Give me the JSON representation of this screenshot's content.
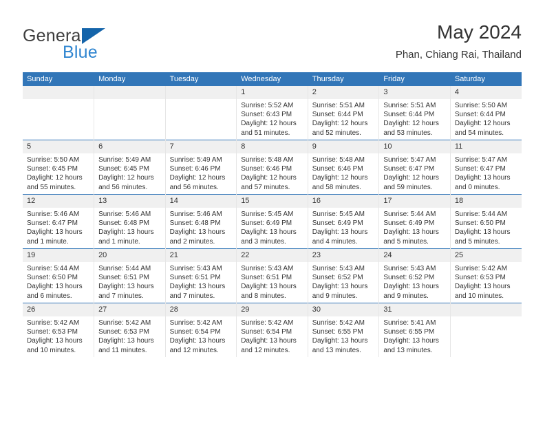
{
  "brand": {
    "name_top": "General",
    "name_bottom": "Blue",
    "triangle_color": "#1464AA",
    "blue_color": "#2F85D0"
  },
  "header": {
    "title": "May 2024",
    "subtitle": "Phan, Chiang Rai, Thailand"
  },
  "theme": {
    "header_blue": "#3276B8",
    "daynum_bg": "#F0F0F0",
    "text": "#333333"
  },
  "weekdays": [
    "Sunday",
    "Monday",
    "Tuesday",
    "Wednesday",
    "Thursday",
    "Friday",
    "Saturday"
  ],
  "weeks": [
    [
      {
        "day": "",
        "empty": true
      },
      {
        "day": "",
        "empty": true
      },
      {
        "day": "",
        "empty": true
      },
      {
        "day": "1",
        "sunrise": "Sunrise: 5:52 AM",
        "sunset": "Sunset: 6:43 PM",
        "daylight1": "Daylight: 12 hours",
        "daylight2": "and 51 minutes."
      },
      {
        "day": "2",
        "sunrise": "Sunrise: 5:51 AM",
        "sunset": "Sunset: 6:44 PM",
        "daylight1": "Daylight: 12 hours",
        "daylight2": "and 52 minutes."
      },
      {
        "day": "3",
        "sunrise": "Sunrise: 5:51 AM",
        "sunset": "Sunset: 6:44 PM",
        "daylight1": "Daylight: 12 hours",
        "daylight2": "and 53 minutes."
      },
      {
        "day": "4",
        "sunrise": "Sunrise: 5:50 AM",
        "sunset": "Sunset: 6:44 PM",
        "daylight1": "Daylight: 12 hours",
        "daylight2": "and 54 minutes."
      }
    ],
    [
      {
        "day": "5",
        "sunrise": "Sunrise: 5:50 AM",
        "sunset": "Sunset: 6:45 PM",
        "daylight1": "Daylight: 12 hours",
        "daylight2": "and 55 minutes."
      },
      {
        "day": "6",
        "sunrise": "Sunrise: 5:49 AM",
        "sunset": "Sunset: 6:45 PM",
        "daylight1": "Daylight: 12 hours",
        "daylight2": "and 56 minutes."
      },
      {
        "day": "7",
        "sunrise": "Sunrise: 5:49 AM",
        "sunset": "Sunset: 6:46 PM",
        "daylight1": "Daylight: 12 hours",
        "daylight2": "and 56 minutes."
      },
      {
        "day": "8",
        "sunrise": "Sunrise: 5:48 AM",
        "sunset": "Sunset: 6:46 PM",
        "daylight1": "Daylight: 12 hours",
        "daylight2": "and 57 minutes."
      },
      {
        "day": "9",
        "sunrise": "Sunrise: 5:48 AM",
        "sunset": "Sunset: 6:46 PM",
        "daylight1": "Daylight: 12 hours",
        "daylight2": "and 58 minutes."
      },
      {
        "day": "10",
        "sunrise": "Sunrise: 5:47 AM",
        "sunset": "Sunset: 6:47 PM",
        "daylight1": "Daylight: 12 hours",
        "daylight2": "and 59 minutes."
      },
      {
        "day": "11",
        "sunrise": "Sunrise: 5:47 AM",
        "sunset": "Sunset: 6:47 PM",
        "daylight1": "Daylight: 13 hours",
        "daylight2": "and 0 minutes."
      }
    ],
    [
      {
        "day": "12",
        "sunrise": "Sunrise: 5:46 AM",
        "sunset": "Sunset: 6:47 PM",
        "daylight1": "Daylight: 13 hours",
        "daylight2": "and 1 minute."
      },
      {
        "day": "13",
        "sunrise": "Sunrise: 5:46 AM",
        "sunset": "Sunset: 6:48 PM",
        "daylight1": "Daylight: 13 hours",
        "daylight2": "and 1 minute."
      },
      {
        "day": "14",
        "sunrise": "Sunrise: 5:46 AM",
        "sunset": "Sunset: 6:48 PM",
        "daylight1": "Daylight: 13 hours",
        "daylight2": "and 2 minutes."
      },
      {
        "day": "15",
        "sunrise": "Sunrise: 5:45 AM",
        "sunset": "Sunset: 6:49 PM",
        "daylight1": "Daylight: 13 hours",
        "daylight2": "and 3 minutes."
      },
      {
        "day": "16",
        "sunrise": "Sunrise: 5:45 AM",
        "sunset": "Sunset: 6:49 PM",
        "daylight1": "Daylight: 13 hours",
        "daylight2": "and 4 minutes."
      },
      {
        "day": "17",
        "sunrise": "Sunrise: 5:44 AM",
        "sunset": "Sunset: 6:49 PM",
        "daylight1": "Daylight: 13 hours",
        "daylight2": "and 5 minutes."
      },
      {
        "day": "18",
        "sunrise": "Sunrise: 5:44 AM",
        "sunset": "Sunset: 6:50 PM",
        "daylight1": "Daylight: 13 hours",
        "daylight2": "and 5 minutes."
      }
    ],
    [
      {
        "day": "19",
        "sunrise": "Sunrise: 5:44 AM",
        "sunset": "Sunset: 6:50 PM",
        "daylight1": "Daylight: 13 hours",
        "daylight2": "and 6 minutes."
      },
      {
        "day": "20",
        "sunrise": "Sunrise: 5:44 AM",
        "sunset": "Sunset: 6:51 PM",
        "daylight1": "Daylight: 13 hours",
        "daylight2": "and 7 minutes."
      },
      {
        "day": "21",
        "sunrise": "Sunrise: 5:43 AM",
        "sunset": "Sunset: 6:51 PM",
        "daylight1": "Daylight: 13 hours",
        "daylight2": "and 7 minutes."
      },
      {
        "day": "22",
        "sunrise": "Sunrise: 5:43 AM",
        "sunset": "Sunset: 6:51 PM",
        "daylight1": "Daylight: 13 hours",
        "daylight2": "and 8 minutes."
      },
      {
        "day": "23",
        "sunrise": "Sunrise: 5:43 AM",
        "sunset": "Sunset: 6:52 PM",
        "daylight1": "Daylight: 13 hours",
        "daylight2": "and 9 minutes."
      },
      {
        "day": "24",
        "sunrise": "Sunrise: 5:43 AM",
        "sunset": "Sunset: 6:52 PM",
        "daylight1": "Daylight: 13 hours",
        "daylight2": "and 9 minutes."
      },
      {
        "day": "25",
        "sunrise": "Sunrise: 5:42 AM",
        "sunset": "Sunset: 6:53 PM",
        "daylight1": "Daylight: 13 hours",
        "daylight2": "and 10 minutes."
      }
    ],
    [
      {
        "day": "26",
        "sunrise": "Sunrise: 5:42 AM",
        "sunset": "Sunset: 6:53 PM",
        "daylight1": "Daylight: 13 hours",
        "daylight2": "and 10 minutes."
      },
      {
        "day": "27",
        "sunrise": "Sunrise: 5:42 AM",
        "sunset": "Sunset: 6:53 PM",
        "daylight1": "Daylight: 13 hours",
        "daylight2": "and 11 minutes."
      },
      {
        "day": "28",
        "sunrise": "Sunrise: 5:42 AM",
        "sunset": "Sunset: 6:54 PM",
        "daylight1": "Daylight: 13 hours",
        "daylight2": "and 12 minutes."
      },
      {
        "day": "29",
        "sunrise": "Sunrise: 5:42 AM",
        "sunset": "Sunset: 6:54 PM",
        "daylight1": "Daylight: 13 hours",
        "daylight2": "and 12 minutes."
      },
      {
        "day": "30",
        "sunrise": "Sunrise: 5:42 AM",
        "sunset": "Sunset: 6:55 PM",
        "daylight1": "Daylight: 13 hours",
        "daylight2": "and 13 minutes."
      },
      {
        "day": "31",
        "sunrise": "Sunrise: 5:41 AM",
        "sunset": "Sunset: 6:55 PM",
        "daylight1": "Daylight: 13 hours",
        "daylight2": "and 13 minutes."
      },
      {
        "day": "",
        "empty": true
      }
    ]
  ]
}
